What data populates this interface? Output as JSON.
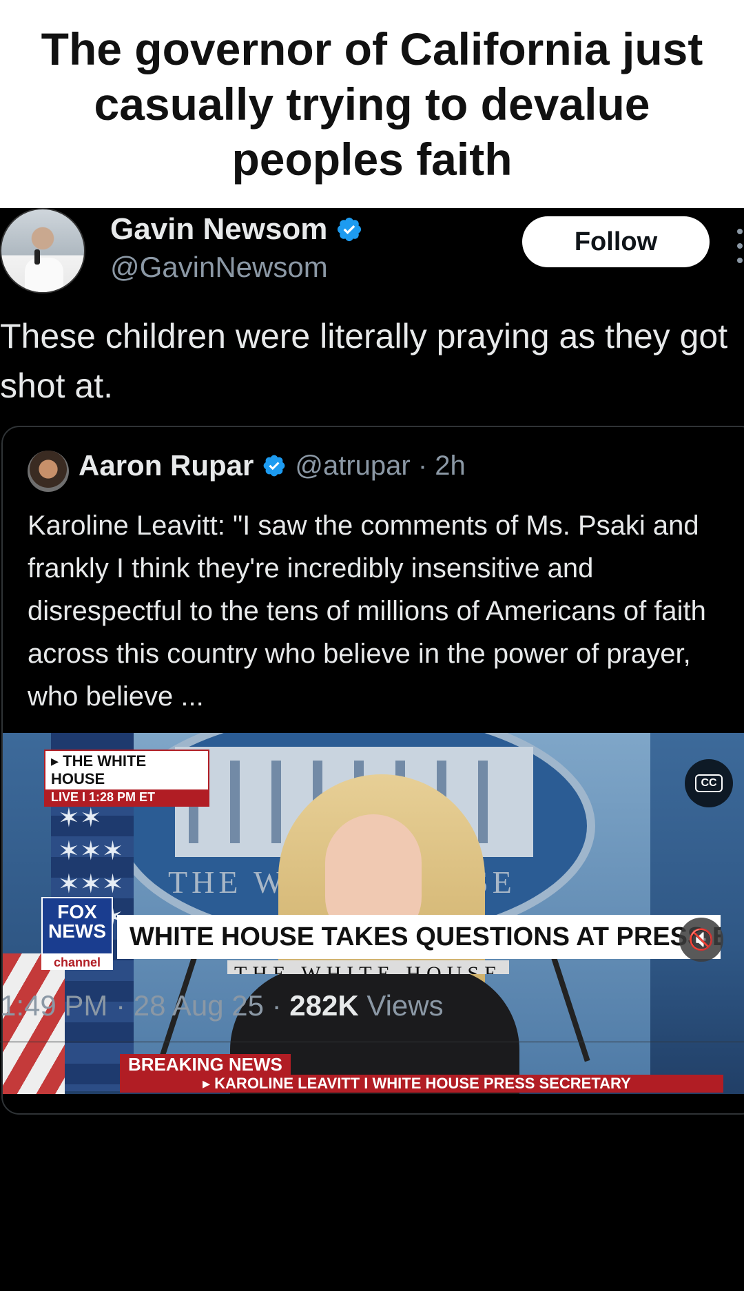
{
  "caption": "The governor of California just casually trying to devalue peoples faith",
  "tweet": {
    "display_name": "Gavin Newsom",
    "handle": "@GavinNewsom",
    "follow_label": "Follow",
    "text": "These children were literally praying as they got shot at.",
    "stats": {
      "time": "1:49 PM",
      "sep1": " · ",
      "date": "28 Aug 25",
      "sep2": " · ",
      "views_count": "282K",
      "views_label": " Views"
    }
  },
  "quoted": {
    "display_name": "Aaron Rupar",
    "handle_time": "@atrupar · 2h",
    "text": "Karoline Leavitt: \"I saw the comments of Ms. Psaki and frankly I think they're incredibly insensitive and disrespectful to the tens of millions of Americans of faith across this country who believe in the power of prayer, who believe ...",
    "video": {
      "live_top": "▸ THE WHITE HOUSE",
      "live_bottom": "LIVE  I  1:28 PM ET",
      "seal_left": "THE WH",
      "seal_right": "USE",
      "breaking": "BREAKING NEWS",
      "name_strip": "▸ KAROLINE LEAVITT I WHITE HOUSE PRESS SECRETARY",
      "headline": "WHITE HOUSE TAKES QUESTIONS AT PRESS BRIEFING",
      "network_top": "FOX",
      "network_mid": "NEWS",
      "network_bottom": "channel",
      "cc_label": "CC",
      "footer_text": "THE WHITE HOUSE"
    }
  },
  "colors": {
    "verified": "#1d9bf0",
    "background": "#000000",
    "secondary_text": "#8b98a5",
    "chyron_red": "#b11d24"
  },
  "icons": [
    "verified-badge-icon",
    "more-icon",
    "closed-captions-icon",
    "mute-icon"
  ]
}
